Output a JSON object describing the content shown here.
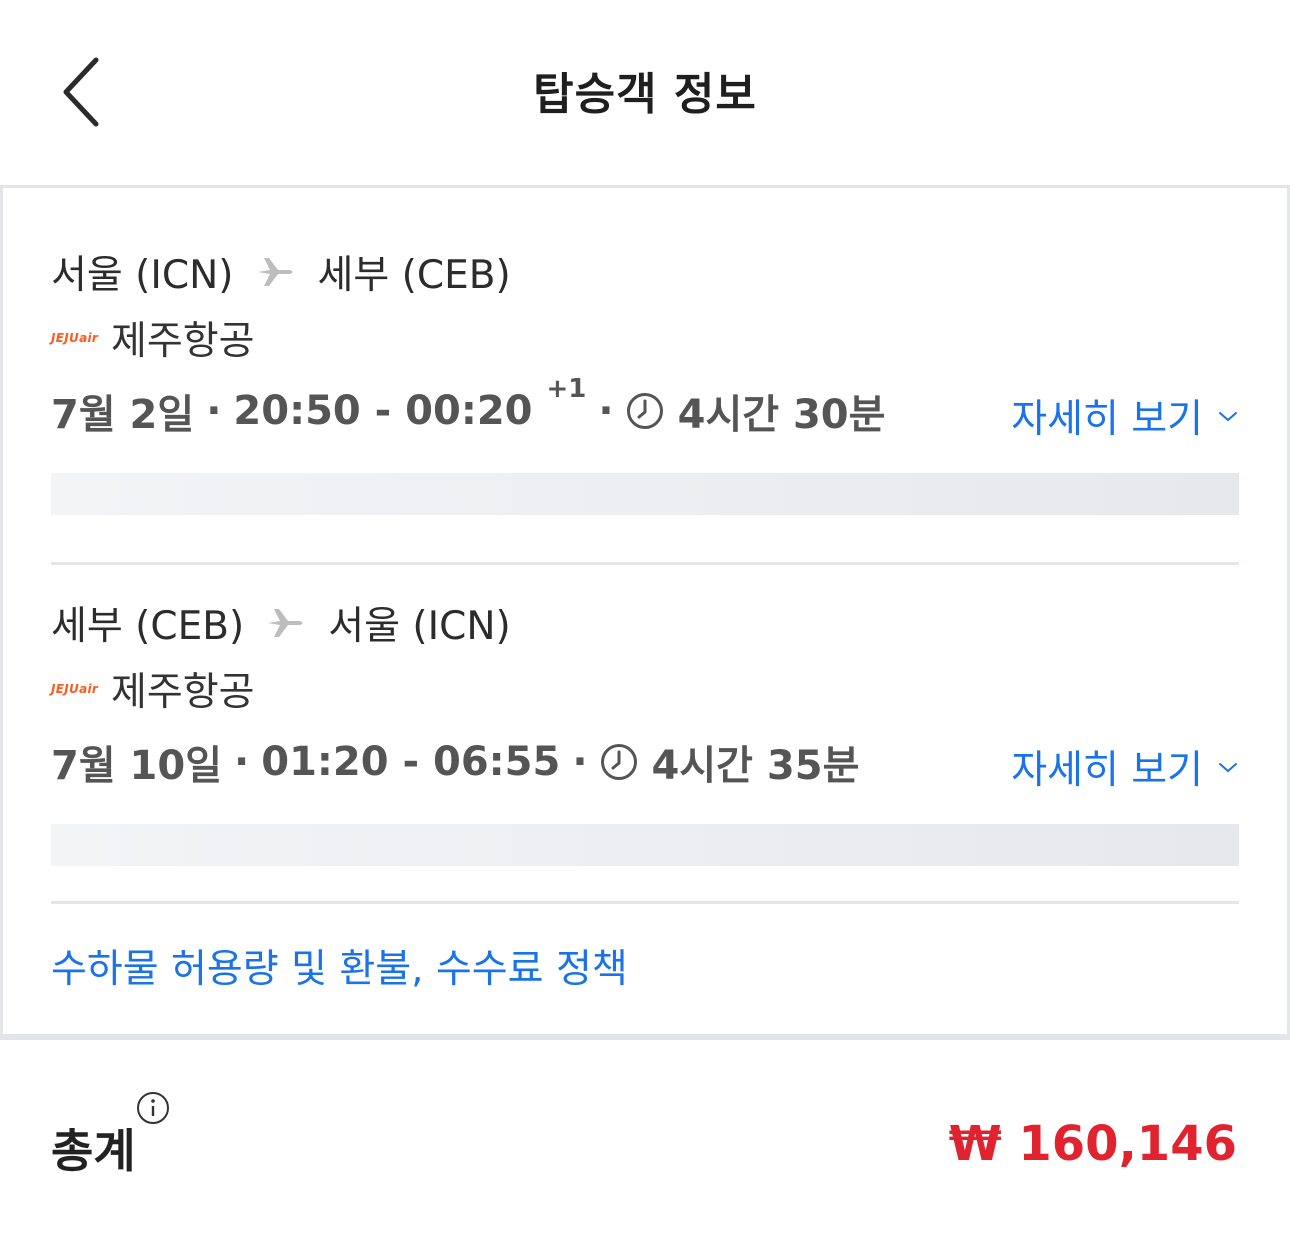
{
  "header": {
    "title": "탑승객 정보"
  },
  "flights": [
    {
      "origin": "서울 (ICN)",
      "destination": "세부 (CEB)",
      "airline_logo": "JEJUair",
      "airline": "제주항공",
      "date": "7월 2일",
      "time_range": "20:50 - 00:20",
      "day_offset": "+1",
      "duration": "4시간 30분",
      "detail_label": "자세히 보기"
    },
    {
      "origin": "세부 (CEB)",
      "destination": "서울 (ICN)",
      "airline_logo": "JEJUair",
      "airline": "제주항공",
      "date": "7월 10일",
      "time_range": "01:20 - 06:55",
      "duration": "4시간 35분",
      "detail_label": "자세히 보기"
    }
  ],
  "policy_link": "수하물 허용량 및 환불, 수수료 정책",
  "total": {
    "label": "총계",
    "amount": "₩ 160,146"
  },
  "colors": {
    "link": "#1a73e8",
    "price": "#e0232e",
    "brand": "#ff5a1f"
  },
  "icons": [
    "back-arrow-icon",
    "plane-icon",
    "clock-icon",
    "chevron-down-icon",
    "info-icon"
  ]
}
